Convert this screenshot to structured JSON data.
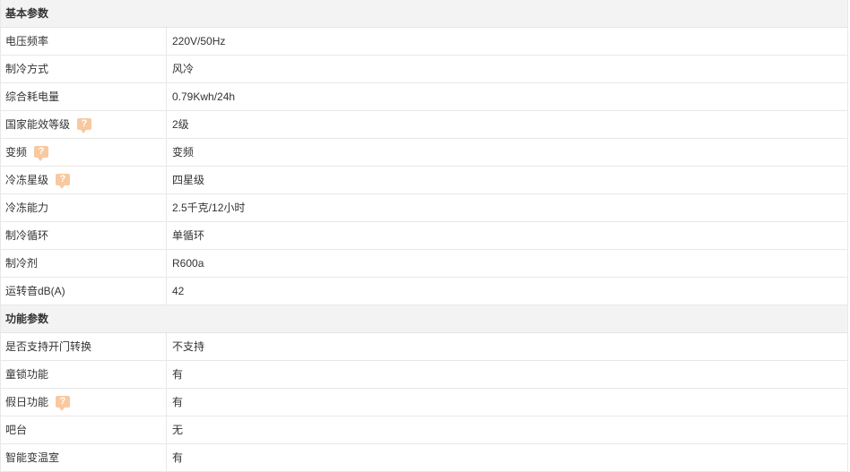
{
  "colors": {
    "header_bg": "#f3f3f3",
    "border": "#e8e8e8",
    "help_icon": "#f8c9a0",
    "text": "#333333"
  },
  "sections": [
    {
      "title": "基本参数",
      "rows": [
        {
          "label": "电压频率",
          "value": "220V/50Hz",
          "help": false
        },
        {
          "label": "制冷方式",
          "value": "风冷",
          "help": false
        },
        {
          "label": "综合耗电量",
          "value": "0.79Kwh/24h",
          "help": false
        },
        {
          "label": "国家能效等级",
          "value": "2级",
          "help": true,
          "help_glyph": "?"
        },
        {
          "label": "变频",
          "value": "变频",
          "help": true,
          "help_glyph": "?"
        },
        {
          "label": "冷冻星级",
          "value": "四星级",
          "help": true,
          "help_glyph": "?"
        },
        {
          "label": "冷冻能力",
          "value": "2.5千克/12小时",
          "help": false
        },
        {
          "label": "制冷循环",
          "value": "单循环",
          "help": false
        },
        {
          "label": "制冷剂",
          "value": "R600a",
          "help": false
        },
        {
          "label": "运转音dB(A)",
          "value": "42",
          "help": false
        }
      ]
    },
    {
      "title": "功能参数",
      "rows": [
        {
          "label": "是否支持开门转换",
          "value": "不支持",
          "help": false
        },
        {
          "label": "童锁功能",
          "value": "有",
          "help": false
        },
        {
          "label": "假日功能",
          "value": "有",
          "help": true,
          "help_glyph": "?"
        },
        {
          "label": "吧台",
          "value": "无",
          "help": false
        },
        {
          "label": "智能变温室",
          "value": "有",
          "help": false
        }
      ]
    }
  ]
}
